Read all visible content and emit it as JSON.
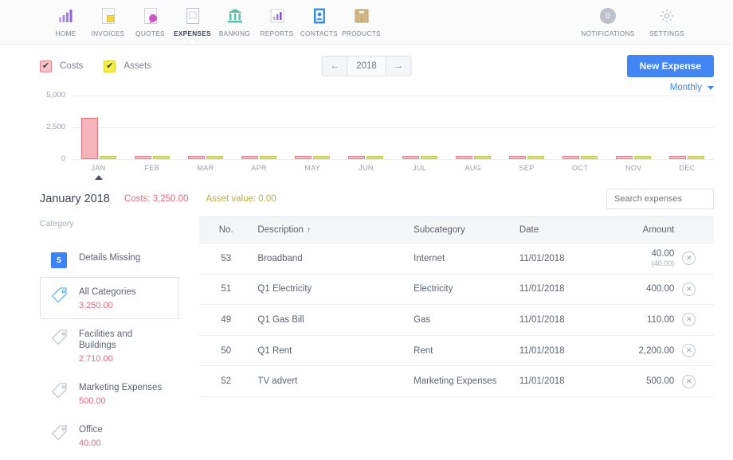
{
  "topnav": {
    "items": [
      {
        "label": "HOME",
        "icon": "bar-chart-icon",
        "active": false
      },
      {
        "label": "INVOICES",
        "icon": "invoice-document-icon",
        "active": false
      },
      {
        "label": "QUOTES",
        "icon": "quote-document-icon",
        "active": false
      },
      {
        "label": "EXPENSES",
        "icon": "expenses-receipt-icon",
        "active": true
      },
      {
        "label": "BANKING",
        "icon": "bank-building-icon",
        "active": false
      },
      {
        "label": "REPORTS",
        "icon": "reports-chart-icon",
        "active": false
      },
      {
        "label": "CONTACTS",
        "icon": "contacts-book-icon",
        "active": false
      },
      {
        "label": "PRODUCTS",
        "icon": "products-box-icon",
        "active": false
      }
    ],
    "right": [
      {
        "label": "NOTIFICATIONS",
        "icon": "notifications-badge-icon",
        "count": "0"
      },
      {
        "label": "SETTINGS",
        "icon": "gear-icon"
      }
    ]
  },
  "filterbar": {
    "legend": [
      {
        "label": "Costs",
        "checked": true,
        "color": "#f8c4c9"
      },
      {
        "label": "Assets",
        "checked": true,
        "color": "#f2ef4a"
      }
    ],
    "year": "2018",
    "prev_icon": "arrow-left-icon",
    "next_icon": "arrow-right-icon",
    "new_expense_label": "New Expense",
    "accent": "#4285f4"
  },
  "chart_controls": {
    "period_label": "Monthly",
    "caret_icon": "chevron-down-icon"
  },
  "chart_data": {
    "type": "bar",
    "title": "",
    "xlabel": "",
    "ylabel": "",
    "ylim": [
      0,
      5000
    ],
    "yticks": [
      "0",
      "2,500",
      "5,000"
    ],
    "grid": true,
    "legend_position": "top-left",
    "categories": [
      "JAN",
      "FEB",
      "MAR",
      "APR",
      "MAY",
      "JUN",
      "JUL",
      "AUG",
      "SEP",
      "OCT",
      "NOV",
      "DEC"
    ],
    "selected_category": "JAN",
    "series": [
      {
        "name": "Costs",
        "color": "#f8c4c9",
        "values": [
          3250,
          0,
          0,
          0,
          0,
          0,
          0,
          0,
          0,
          0,
          0,
          0
        ]
      },
      {
        "name": "Assets",
        "color": "#dde37e",
        "values": [
          0,
          0,
          0,
          0,
          0,
          0,
          0,
          0,
          0,
          0,
          0,
          0
        ]
      }
    ]
  },
  "summary": {
    "period": "January 2018",
    "costs": "Costs: 3,250.00",
    "assets": "Asset value: 0.00",
    "costs_color": "#e8697c",
    "assets_color": "#b4b33d"
  },
  "search": {
    "placeholder": "Search expenses",
    "value": ""
  },
  "sidebar": {
    "heading": "Category",
    "items": [
      {
        "label": "Details Missing",
        "amount": "",
        "badge": "5",
        "icon": "badge-count-icon",
        "selected": false
      },
      {
        "label": "All Categories",
        "amount": "3.250.00",
        "badge": "",
        "icon": "tag-icon-selected",
        "selected": true
      },
      {
        "label": "Facilities and Buildings",
        "amount": "2.710.00",
        "badge": "",
        "icon": "tag-icon",
        "selected": false
      },
      {
        "label": "Marketing Expenses",
        "amount": "500.00",
        "badge": "",
        "icon": "tag-icon",
        "selected": false
      },
      {
        "label": "Office",
        "amount": "40.00",
        "badge": "",
        "icon": "tag-icon",
        "selected": false
      }
    ]
  },
  "table": {
    "columns": {
      "no": "No.",
      "description": "Description",
      "sort_icon": "↑",
      "subcategory": "Subcategory",
      "date": "Date",
      "amount": "Amount"
    },
    "rows": [
      {
        "no": "53",
        "description": "Broadband",
        "subcategory": "Internet",
        "date": "11/01/2018",
        "amount": "40.00",
        "sub_amount": "(40.00)",
        "delete_icon": "circle-x-icon"
      },
      {
        "no": "51",
        "description": "Q1 Electricity",
        "subcategory": "Electricity",
        "date": "11/01/2018",
        "amount": "400.00",
        "sub_amount": "",
        "delete_icon": "circle-x-icon"
      },
      {
        "no": "49",
        "description": "Q1 Gas Bill",
        "subcategory": "Gas",
        "date": "11/01/2018",
        "amount": "110.00",
        "sub_amount": "",
        "delete_icon": "circle-x-icon"
      },
      {
        "no": "50",
        "description": "Q1 Rent",
        "subcategory": "Rent",
        "date": "11/01/2018",
        "amount": "2,200.00",
        "sub_amount": "",
        "delete_icon": "circle-x-icon"
      },
      {
        "no": "52",
        "description": "TV advert",
        "subcategory": "Marketing Expenses",
        "date": "11/01/2018",
        "amount": "500.00",
        "sub_amount": "",
        "delete_icon": "circle-x-icon"
      }
    ]
  }
}
